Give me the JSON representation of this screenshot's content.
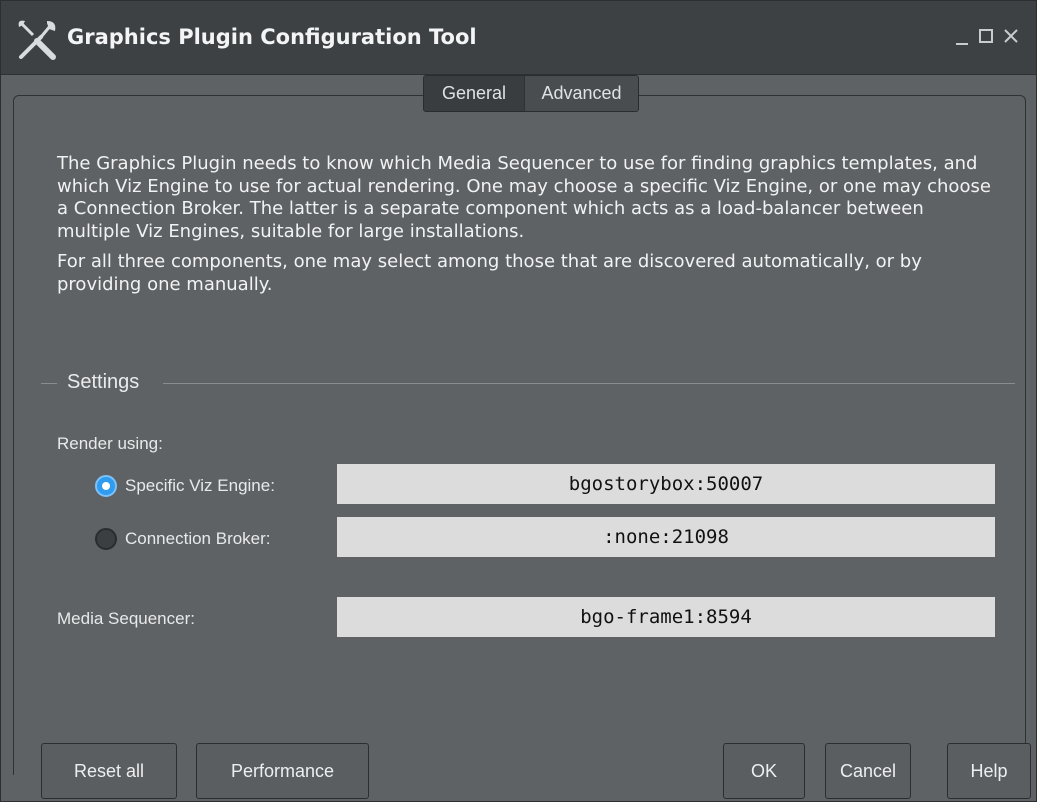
{
  "window": {
    "title": "Graphics Plugin Configuration Tool",
    "controls": {
      "minimize": "minimize-icon",
      "maximize": "maximize-icon",
      "close": "close-icon"
    }
  },
  "tabs": [
    {
      "label": "General",
      "active": true
    },
    {
      "label": "Advanced",
      "active": false
    }
  ],
  "description": {
    "paragraph1": "The Graphics Plugin needs to know which Media Sequencer to use for finding graphics templates, and which Viz Engine to use for actual rendering. One may choose a specific Viz Engine, or one may choose a Connection Broker. The latter is a separate component which acts as a load-balancer between multiple Viz Engines, suitable for large installations.",
    "paragraph2": "For all three components, one may select among those that are discovered automatically, or by providing one manually."
  },
  "settings": {
    "title": "Settings",
    "render_using_label": "Render using:",
    "options": [
      {
        "label": "Specific Viz Engine:",
        "value": "bgostorybox:50007",
        "selected": true
      },
      {
        "label": "Connection Broker:",
        "value": ":none:21098",
        "selected": false
      }
    ],
    "media_sequencer": {
      "label": "Media Sequencer:",
      "value": "bgo-frame1:8594"
    }
  },
  "buttons": {
    "reset_all": "Reset all",
    "performance": "Performance",
    "ok": "OK",
    "cancel": "Cancel",
    "help": "Help"
  },
  "colors": {
    "accent": "#2f9cf0",
    "background": "#5f6265",
    "titlebar": "#3e4144",
    "field": "#dcdcdc"
  }
}
